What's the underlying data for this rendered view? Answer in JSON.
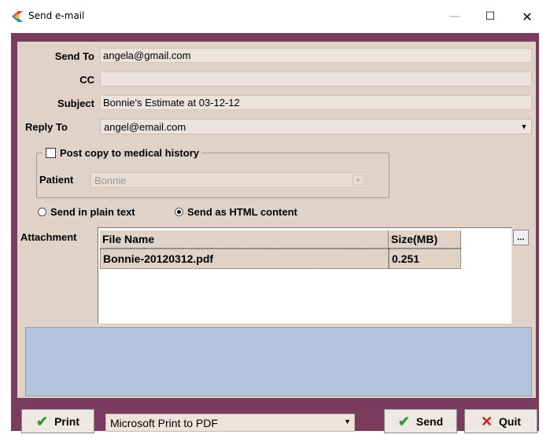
{
  "window": {
    "title": "Send e-mail",
    "min_glyph": "—",
    "max_glyph": "☐",
    "close_glyph": "✕"
  },
  "form": {
    "send_to": {
      "label": "Send To",
      "value": "angela@gmail.com"
    },
    "cc": {
      "label": "CC",
      "value": ""
    },
    "subject": {
      "label": "Subject",
      "value": "Bonnie's Estimate at 03-12-12"
    },
    "reply_to": {
      "label": "Reply To",
      "value": "angel@email.com"
    }
  },
  "medical_history": {
    "checkbox_label": "Post copy to medical history",
    "checked": false,
    "patient_label": "Patient",
    "patient_value": "Bonnie"
  },
  "format": {
    "plain_label": "Send in plain text",
    "html_label": "Send as HTML content",
    "selected": "html"
  },
  "attachments": {
    "label": "Attachment",
    "columns": [
      "File Name",
      "Size(MB)"
    ],
    "rows": [
      {
        "file_name": "Bonnie-20120312.pdf",
        "size": "0.251"
      }
    ],
    "browse_label": "..."
  },
  "footer": {
    "print_label": "Print",
    "printer_value": "Microsoft Print to PDF",
    "send_label": "Send",
    "quit_label": "Quit"
  },
  "colors": {
    "frame": "#7a3c5e",
    "panel": "#e0d2c7",
    "message_area": "#b4c4df"
  },
  "icons": {
    "app": "app-logo-icon",
    "print": "checkmark-icon",
    "send": "checkmark-icon",
    "quit": "x-icon",
    "dropdown": "dropdown-arrow-icon"
  }
}
